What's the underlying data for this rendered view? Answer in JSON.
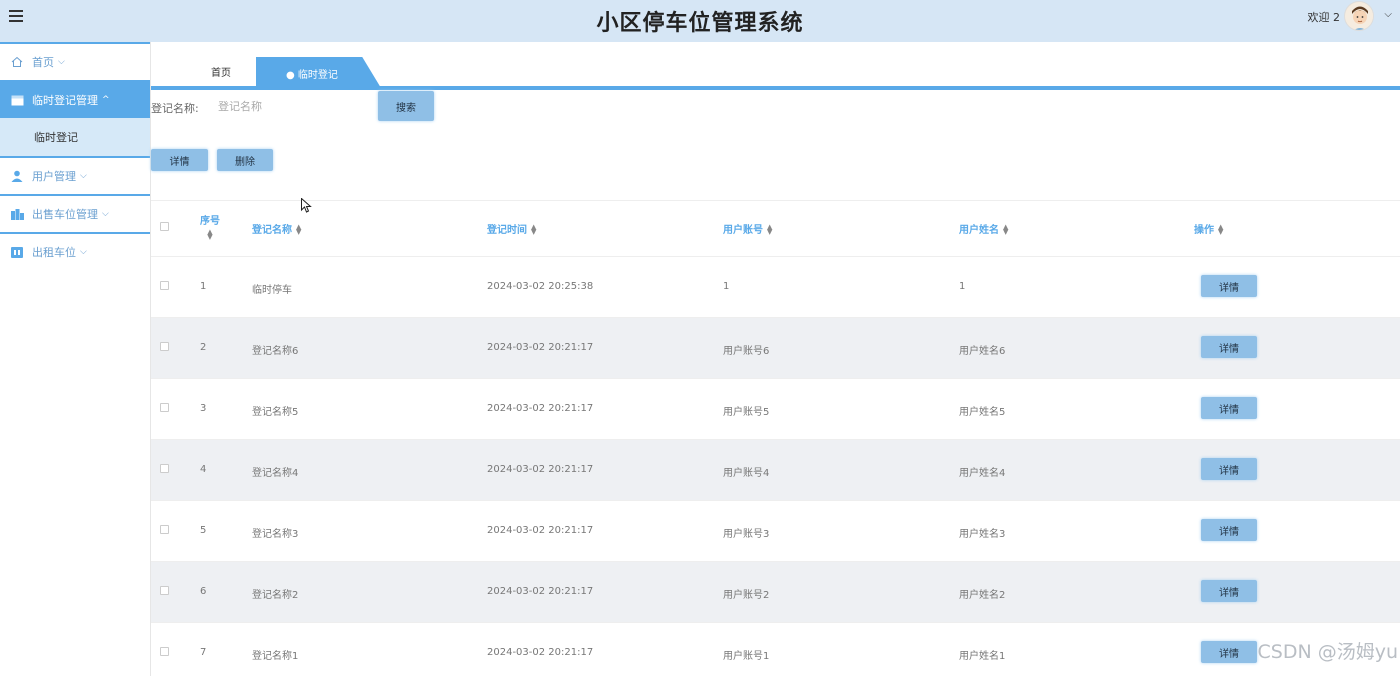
{
  "header": {
    "title": "小区停车位管理系统",
    "welcome": "欢迎 2"
  },
  "sidebar": {
    "items": [
      {
        "label": "首页",
        "icon": "home-icon"
      },
      {
        "label": "临时登记管理",
        "icon": "calendar-icon",
        "active": true,
        "expanded": true,
        "children": [
          {
            "label": "临时登记"
          }
        ]
      },
      {
        "label": "用户管理",
        "icon": "user-icon"
      },
      {
        "label": "出售车位管理",
        "icon": "building-icon"
      },
      {
        "label": "出租车位",
        "icon": "parking-icon"
      }
    ]
  },
  "tabs": {
    "home": "首页",
    "active": "● 临时登记",
    "close": "×"
  },
  "search": {
    "label": "登记名称:",
    "placeholder": "登记名称",
    "button": "搜索"
  },
  "actions": {
    "detail": "详情",
    "delete": "删除"
  },
  "table": {
    "columns": [
      "序号",
      "登记名称",
      "登记时间",
      "用户账号",
      "用户姓名",
      "操作"
    ],
    "rows": [
      {
        "no": "1",
        "name": "临时停车",
        "time": "2024-03-02 20:25:38",
        "account": "1",
        "username": "1",
        "action": "详情"
      },
      {
        "no": "2",
        "name": "登记名称6",
        "time": "2024-03-02 20:21:17",
        "account": "用户账号6",
        "username": "用户姓名6",
        "action": "详情"
      },
      {
        "no": "3",
        "name": "登记名称5",
        "time": "2024-03-02 20:21:17",
        "account": "用户账号5",
        "username": "用户姓名5",
        "action": "详情"
      },
      {
        "no": "4",
        "name": "登记名称4",
        "time": "2024-03-02 20:21:17",
        "account": "用户账号4",
        "username": "用户姓名4",
        "action": "详情"
      },
      {
        "no": "5",
        "name": "登记名称3",
        "time": "2024-03-02 20:21:17",
        "account": "用户账号3",
        "username": "用户姓名3",
        "action": "详情"
      },
      {
        "no": "6",
        "name": "登记名称2",
        "time": "2024-03-02 20:21:17",
        "account": "用户账号2",
        "username": "用户姓名2",
        "action": "详情"
      },
      {
        "no": "7",
        "name": "登记名称1",
        "time": "2024-03-02 20:21:17",
        "account": "用户账号1",
        "username": "用户姓名1",
        "action": "详情"
      }
    ]
  },
  "watermark": "CSDN @汤姆yu",
  "colors": {
    "accent": "#59a9e8",
    "header_bg": "#d6e6f5",
    "button_bg": "#8fbfe6",
    "row_alt": "#eef0f3"
  }
}
